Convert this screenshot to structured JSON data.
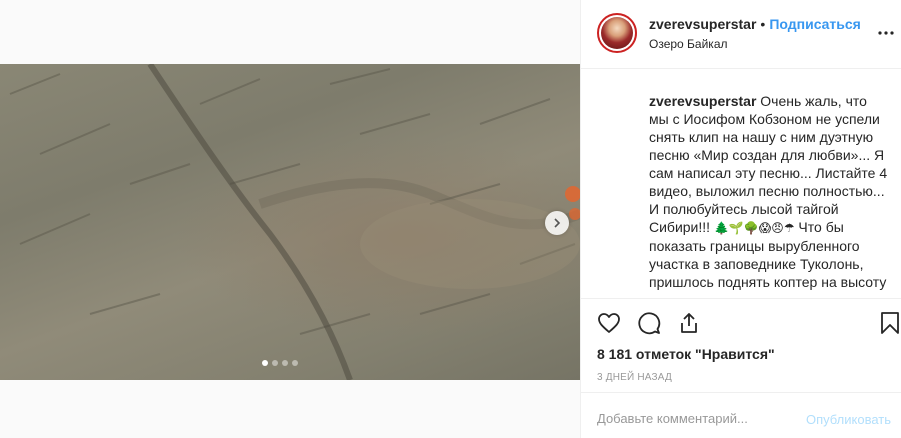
{
  "post": {
    "username": "zverevsuperstar",
    "follow_label": "Подписаться",
    "separator": "•",
    "location": "Озеро Байкал",
    "more_icon": "ellipsis-icon",
    "caption_username": "zverevsuperstar",
    "caption_text": "Очень жаль, что мы с Иосифом Кобзоном не успели снять клип на нашу с ним дуэтную песню «Мир создан для любви»... Я сам написал эту песню... Листайте 4 видео, выложил песню полностью... И полюбуйтесь лысой тайгой Сибири!!! ",
    "caption_emojis": "🌲🌱🌳😱😠☂",
    "caption_text_2": " Что бы показать границы вырубленного участка в заповеднике Туколонь, пришлось поднять коптер на высоту",
    "likes": "8 181 отметок \"Нравится\"",
    "time": "3 ДНЕЙ НАЗАД"
  },
  "media": {
    "next_icon": "chevron-right-icon",
    "carousel_total": 4,
    "carousel_active": 1
  },
  "actions": {
    "like_icon": "heart-icon",
    "comment_icon": "comment-icon",
    "share_icon": "share-icon",
    "save_icon": "bookmark-icon"
  },
  "comment_box": {
    "placeholder": "Добавьте комментарий...",
    "publish_label": "Опубликовать"
  },
  "colors": {
    "accent": "#3897f0",
    "publish_disabled": "#b2dffc",
    "muted": "#999999"
  }
}
